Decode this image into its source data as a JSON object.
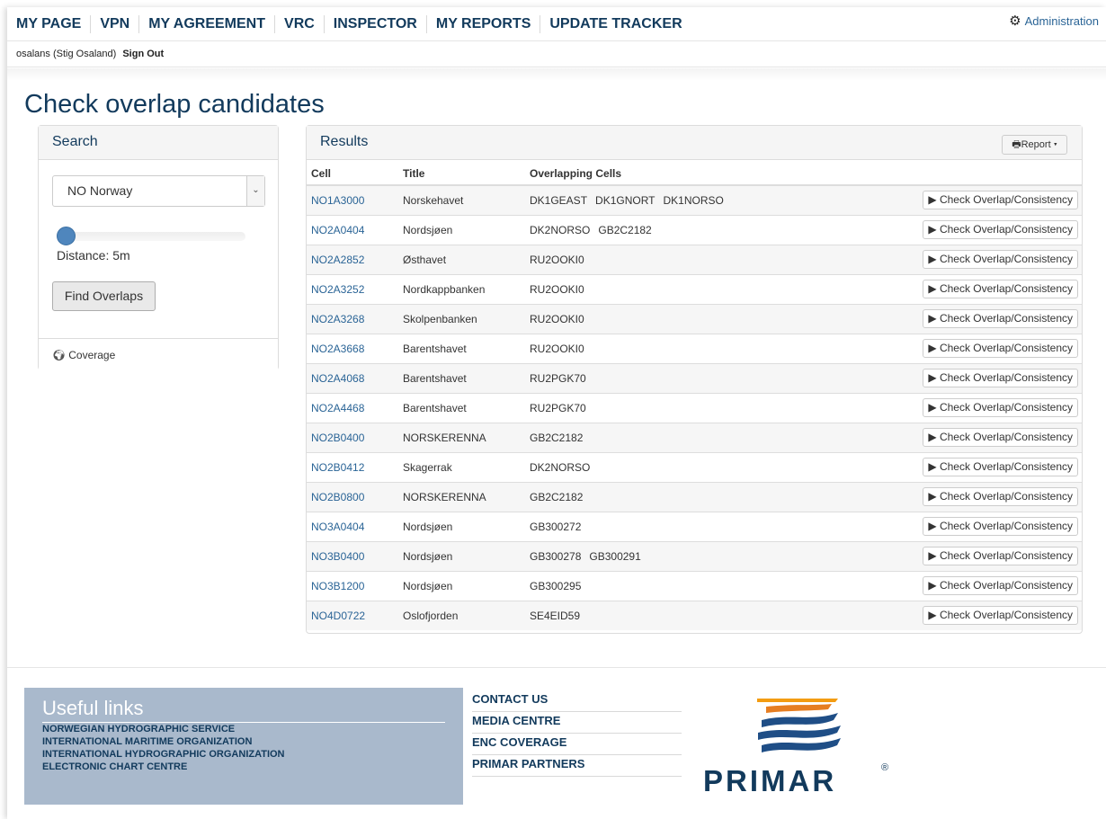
{
  "nav": {
    "items": [
      "MY PAGE",
      "VPN",
      "MY AGREEMENT",
      "VRC",
      "INSPECTOR",
      "MY REPORTS",
      "UPDATE TRACKER"
    ],
    "admin_label": "Administration"
  },
  "user": {
    "name": "osalans (Stig Osaland)",
    "signout": "Sign Out"
  },
  "page_title": "Check overlap candidates",
  "search": {
    "heading": "Search",
    "country": "NO Norway",
    "distance_label": "Distance: 5m",
    "slider_value": 0,
    "find_label": "Find Overlaps",
    "coverage_label": "Coverage"
  },
  "results": {
    "heading": "Results",
    "report_label": "Report",
    "columns": [
      "Cell",
      "Title",
      "Overlapping Cells"
    ],
    "check_label": "Check Overlap/Consistency",
    "rows": [
      {
        "cell": "NO1A3000",
        "title": "Norskehavet",
        "overlaps": [
          "DK1GEAST",
          "DK1GNORT",
          "DK1NORSO"
        ]
      },
      {
        "cell": "NO2A0404",
        "title": "Nordsjøen",
        "overlaps": [
          "DK2NORSO",
          "GB2C2182"
        ]
      },
      {
        "cell": "NO2A2852",
        "title": "Østhavet",
        "overlaps": [
          "RU2OOKI0"
        ]
      },
      {
        "cell": "NO2A3252",
        "title": "Nordkappbanken",
        "overlaps": [
          "RU2OOKI0"
        ]
      },
      {
        "cell": "NO2A3268",
        "title": "Skolpenbanken",
        "overlaps": [
          "RU2OOKI0"
        ]
      },
      {
        "cell": "NO2A3668",
        "title": "Barentshavet",
        "overlaps": [
          "RU2OOKI0"
        ]
      },
      {
        "cell": "NO2A4068",
        "title": "Barentshavet",
        "overlaps": [
          "RU2PGK70"
        ]
      },
      {
        "cell": "NO2A4468",
        "title": "Barentshavet",
        "overlaps": [
          "RU2PGK70"
        ]
      },
      {
        "cell": "NO2B0400",
        "title": "NORSKERENNA",
        "overlaps": [
          "GB2C2182"
        ]
      },
      {
        "cell": "NO2B0412",
        "title": "Skagerrak",
        "overlaps": [
          "DK2NORSO"
        ]
      },
      {
        "cell": "NO2B0800",
        "title": "NORSKERENNA",
        "overlaps": [
          "GB2C2182"
        ]
      },
      {
        "cell": "NO3A0404",
        "title": "Nordsjøen",
        "overlaps": [
          "GB300272"
        ]
      },
      {
        "cell": "NO3B0400",
        "title": "Nordsjøen",
        "overlaps": [
          "GB300278",
          "GB300291"
        ]
      },
      {
        "cell": "NO3B1200",
        "title": "Nordsjøen",
        "overlaps": [
          "GB300295"
        ]
      },
      {
        "cell": "NO4D0722",
        "title": "Oslofjorden",
        "overlaps": [
          "SE4EID59"
        ]
      }
    ]
  },
  "footer": {
    "useful_title": "Useful links",
    "useful_links": [
      "NORWEGIAN HYDROGRAPHIC SERVICE",
      "INTERNATIONAL MARITIME ORGANIZATION",
      "INTERNATIONAL HYDROGRAPHIC ORGANIZATION",
      "ELECTRONIC CHART CENTRE"
    ],
    "links": [
      "CONTACT US",
      "MEDIA CENTRE",
      "ENC COVERAGE",
      "PRIMAR PARTNERS"
    ],
    "logo_text": "PRIMAR",
    "logo_reg": "®"
  },
  "colors": {
    "brand": "#123a5c",
    "link": "#2a6496",
    "useful_bg": "#a9b9cc",
    "logo_orange": "#f39c12"
  }
}
